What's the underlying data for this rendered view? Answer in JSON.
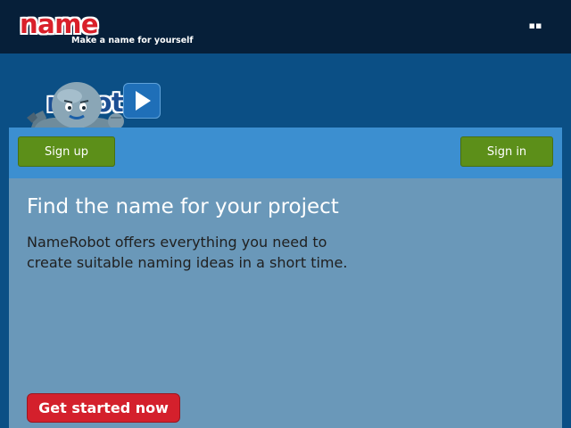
{
  "header": {
    "logo_part1": "name",
    "logo_part2": "robot",
    "tagline": "Make a name for yourself",
    "menu_icon": "menu-dots-icon"
  },
  "hero": {
    "robot_icon": "robot-mascot-icon",
    "play_icon": "play-icon"
  },
  "panel": {
    "signup_label": "Sign up",
    "signin_label": "Sign in",
    "headline": "Find the name for your project",
    "subtext_line1": "NameRobot offers everything you need to",
    "subtext_line2": "create suitable naming ideas in a short time.",
    "cta_label": "Get started now"
  },
  "colors": {
    "topbar": "#061f39",
    "page_background": "#0b4f85",
    "panel_bar": "#3c8fd0",
    "panel_body": "#6a98b9",
    "green_button": "#5c8f19",
    "cta_button": "#d4202c",
    "logo_red": "#d9202a",
    "logo_blue": "#1d4f93"
  }
}
